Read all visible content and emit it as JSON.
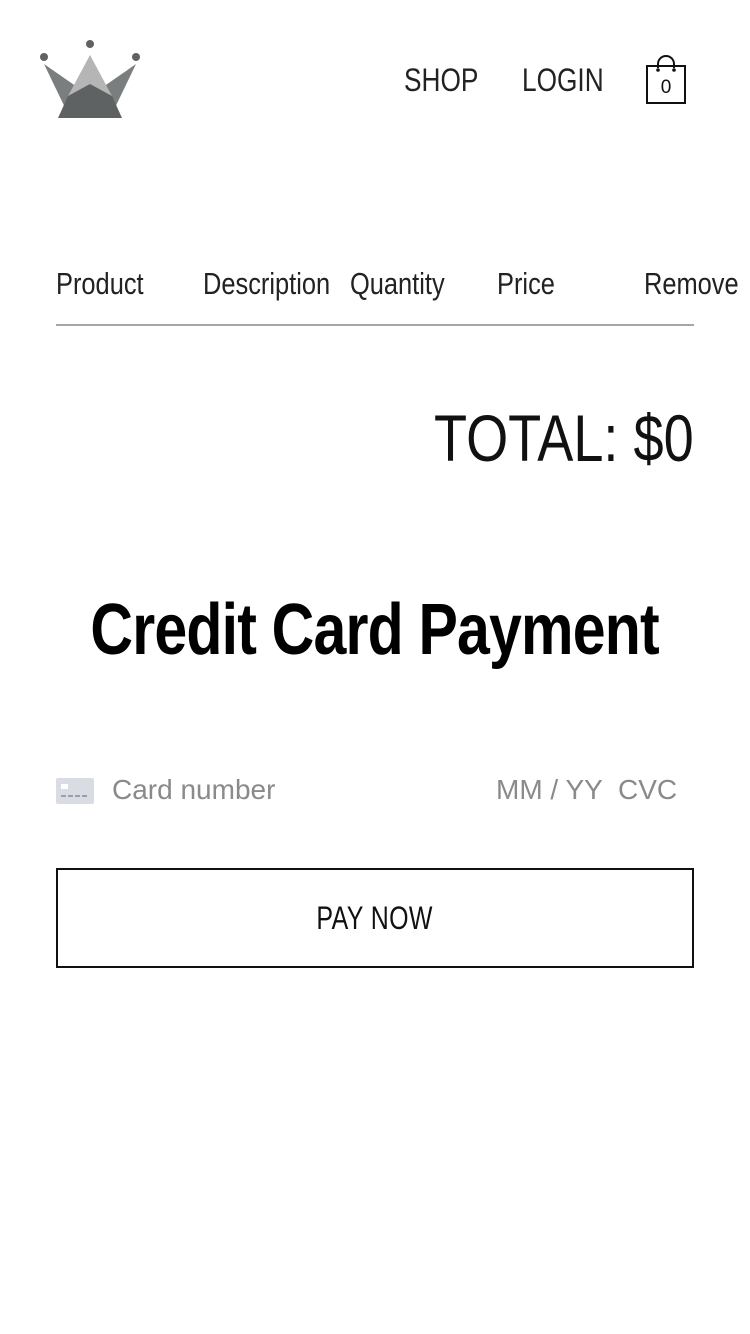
{
  "header": {
    "logo_icon": "crown-logo-icon",
    "nav": {
      "shop_label": "SHOP",
      "login_label": "LOGIN"
    },
    "cart": {
      "icon": "shopping-bag-icon",
      "count": "0"
    }
  },
  "cart_table": {
    "columns": [
      "Product",
      "Description",
      "Quantity",
      "Price",
      "Remove"
    ],
    "rows": []
  },
  "total": {
    "text": "TOTAL: $0"
  },
  "payment": {
    "title": "Credit Card Payment",
    "card_icon": "credit-card-icon",
    "card_number_placeholder": "Card number",
    "expiry_placeholder": "MM / YY",
    "cvc_placeholder": "CVC",
    "pay_button_label": "PAY NOW"
  },
  "colors": {
    "crown_light": "#b5b5b5",
    "crown_dark": "#5e6263",
    "divider": "#a6a6a6",
    "placeholder": "#8a8a8a"
  }
}
